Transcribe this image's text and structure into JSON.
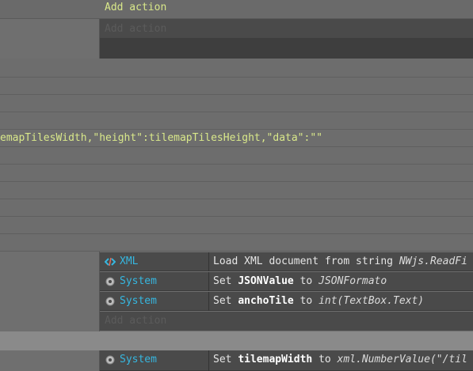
{
  "top_add_action": "Add action",
  "faded_add_action": "Add action",
  "code_line": "emapTilesWidth,\"height\":tilemapTilesHeight,\"data\":\"\"",
  "actions": [
    {
      "object": "XML",
      "icon": "xml-icon",
      "verb": "Load XML document from string",
      "target": "",
      "prep": "",
      "value": "NWjs.ReadFi"
    },
    {
      "object": "System",
      "icon": "gear-icon",
      "verb": "Set",
      "target": "JSONValue",
      "prep": "to",
      "value": "JSONFormato"
    },
    {
      "object": "System",
      "icon": "gear-icon",
      "verb": "Set",
      "target": "anchoTile",
      "prep": "to",
      "value": "int(TextBox.Text)"
    }
  ],
  "bottom_add_action": "Add action",
  "last_action": {
    "object": "System",
    "icon": "gear-icon",
    "verb": "Set",
    "target": "tilemapWidth",
    "prep": "to",
    "value": "xml.NumberValue(\"/til"
  }
}
